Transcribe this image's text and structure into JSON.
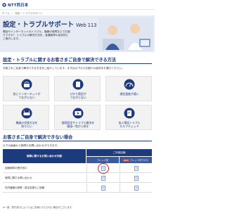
{
  "header": {
    "logo_text": "NTT西日本"
  },
  "breadcrumb": [
    "ホーム",
    "›",
    "設定・トラブルサポート"
  ],
  "hero": {
    "title": "設定・トラブルサポート",
    "version": "Web 113",
    "description": "電話やインターネットのトラブル、機器の故障などでお困りですか？ トラブルの解決方法を、各種故障の症状別にご案内します。"
  },
  "section1": {
    "title": "設定・トラブルに関するお客さまご自身で解決できる方法",
    "intro": "お客さまご自身で解決できる方法をご紹介しています。まずは以下からお困りの症状をお選びください。",
    "cards": [
      {
        "label": "急にインターネットが\nつながらない",
        "icon": "wifi-laptop-icon"
      },
      {
        "label": "ひかり電話が\nつながらない",
        "icon": "phone-icon"
      },
      {
        "label": "通信速度が遅い",
        "icon": "speed-icon"
      },
      {
        "label": "機器の交換方法を\n知りたい",
        "icon": "router-icon"
      },
      {
        "label": "接続設定やトラブル解決を\n動画一覧から探す",
        "icon": "video-icon"
      },
      {
        "label": "加入電話トラブル\nセルフチェック",
        "icon": "checklist-icon"
      }
    ]
  },
  "section2": {
    "title": "お客さまご自身で解決できない場合",
    "intro": "以下の画面から故障のお問い合わせができます。",
    "table": {
      "left_header": "故障に関するお問い合わせ内容",
      "top_header": "ご利用回線",
      "col_a": "フレッツ光",
      "col_b_tag": "NEW",
      "col_b": "フレッツ光クロス",
      "rows": [
        {
          "label": "回線故障の受付窓口",
          "has_a": true,
          "has_b": true,
          "highlight_a": true
        },
        {
          "label": "故障に関する問い合わせ",
          "has_a": true,
          "has_b": true,
          "highlight_a": false
        },
        {
          "label": "宅内機器の故障・設定変更のご依頼",
          "has_a": true,
          "has_b": true,
          "highlight_a": false
        }
      ]
    }
  },
  "footnote": "※一部、受付窓口によってはご利用いただけない場合がございます。"
}
